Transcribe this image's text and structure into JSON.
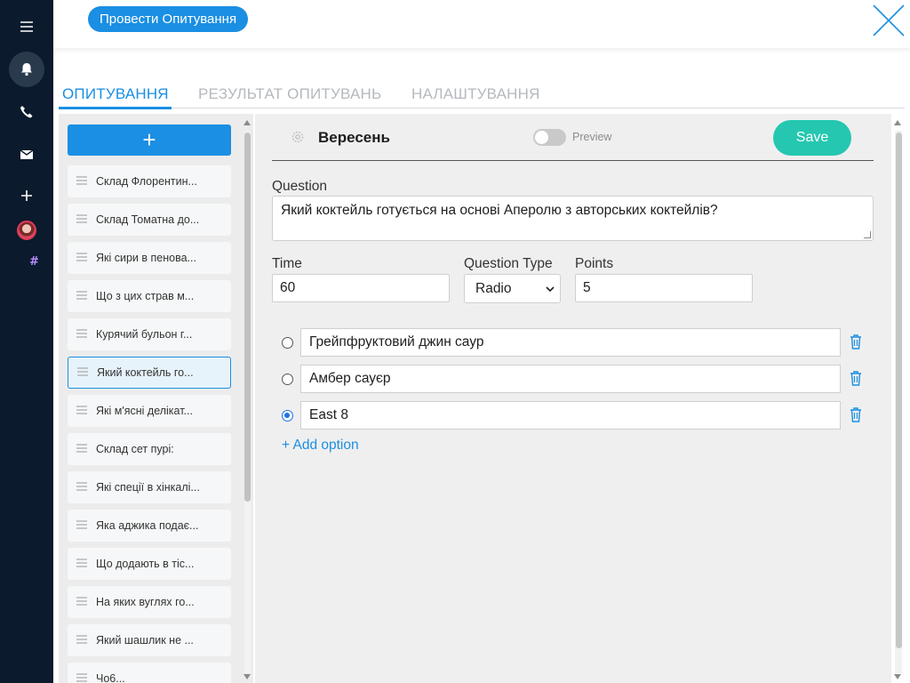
{
  "toolbar": {
    "run_quiz_label": "Провести Опитування"
  },
  "tabs": [
    {
      "label": "ОПИТУВАННЯ",
      "active": true
    },
    {
      "label": "РЕЗУЛЬТАТ ОПИТУВАНЬ",
      "active": false
    },
    {
      "label": "НАЛАШТУВАННЯ",
      "active": false
    }
  ],
  "questions_list": {
    "add_label": "+",
    "items": [
      "Склад Флорентин...",
      "Склад Томатна до...",
      "Які сири в пенова...",
      "Що з цих страв м...",
      "Курячий бульон г...",
      "Який коктейль го...",
      "Які м'ясні делікат...",
      "Склад сет пурі:",
      "Які спеції в хінкалі...",
      "Яка аджика подає...",
      "Що додають в тіс...",
      "На яких вуглях го...",
      "Який шашлик не ...",
      "Чо6..."
    ],
    "active_index": 5
  },
  "editor": {
    "quiz_title": "Вересень",
    "preview_label": "Preview",
    "preview_on": false,
    "save_label": "Save",
    "question_label": "Question",
    "question_text": "Який коктейль готується на основі Аперолю з авторських коктейлів?",
    "time_label": "Time",
    "time_value": "60",
    "question_type_label": "Question Type",
    "question_type_value": "Radio",
    "points_label": "Points",
    "points_value": "5",
    "options": [
      {
        "text": "Грейпфруктовий джин саур",
        "selected": false
      },
      {
        "text": "Амбер сауєр",
        "selected": false
      },
      {
        "text": "East 8",
        "selected": true
      }
    ],
    "add_option_label": "+ Add option"
  },
  "colors": {
    "accent": "#1a8fe3",
    "save": "#25c7b0",
    "rail": "#0b1a2c"
  },
  "icons": [
    "menu-icon",
    "bell-icon",
    "phone-icon",
    "mail-icon",
    "plus-icon",
    "hash-icon",
    "close-icon",
    "gear-icon",
    "trash-icon"
  ]
}
